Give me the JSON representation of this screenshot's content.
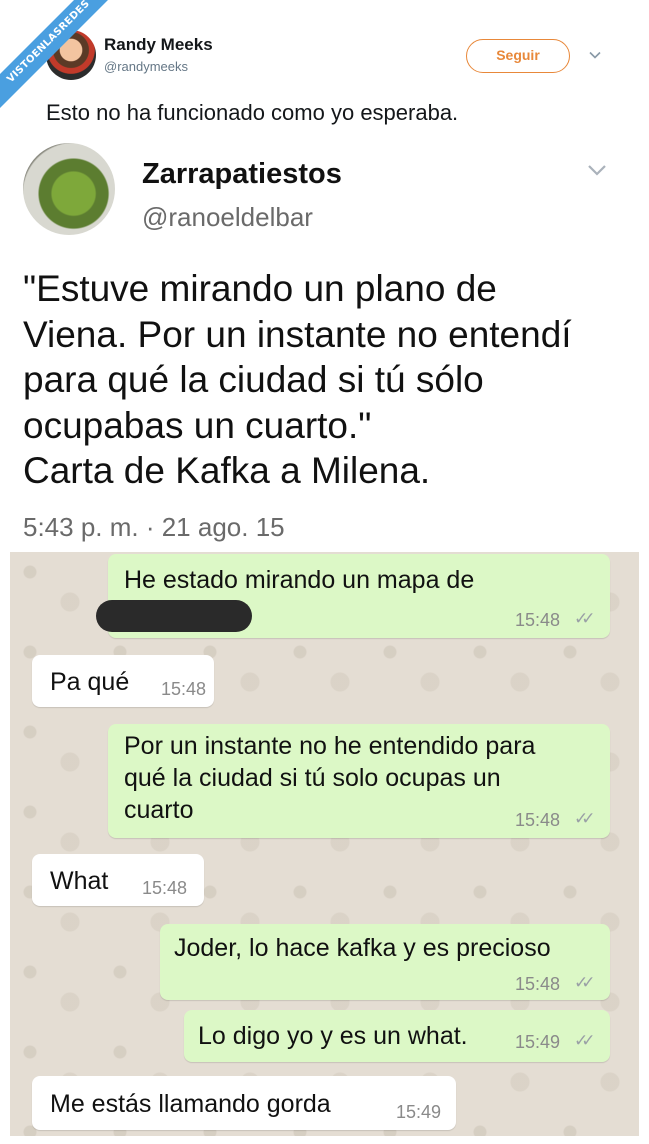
{
  "watermark": "VISTOENLASREDES",
  "tweet": {
    "author_name": "Randy Meeks",
    "author_handle": "@randymeeks",
    "follow_label": "Seguir",
    "text": "Esto no ha funcionado como yo esperaba."
  },
  "embedded_tweet": {
    "author_name": "Zarrapatiestos",
    "author_handle": "@ranoeldelbar",
    "lines": [
      "\"Estuve mirando un plano de",
      "Viena. Por un instante no entendí",
      "para qué la ciudad si tú sólo",
      "ocupabas un cuarto.\"",
      "Carta de Kafka a Milena."
    ],
    "date": "5:43 p. m. · 21 ago. 15"
  },
  "chat": {
    "messages": [
      {
        "direction": "out",
        "lines": [
          "He estado mirando un mapa de"
        ],
        "time": "15:48",
        "redacted": true
      },
      {
        "direction": "in",
        "lines": [
          "Pa qué"
        ],
        "time": "15:48"
      },
      {
        "direction": "out",
        "lines": [
          "Por un instante no he entendido para",
          "qué la ciudad si tú solo ocupas un",
          "cuarto"
        ],
        "time": "15:48"
      },
      {
        "direction": "in",
        "lines": [
          "What"
        ],
        "time": "15:48"
      },
      {
        "direction": "out",
        "lines": [
          "Joder, lo hace kafka y es precioso"
        ],
        "time": "15:48"
      },
      {
        "direction": "out",
        "lines": [
          "Lo digo yo y es un what."
        ],
        "time": "15:49"
      },
      {
        "direction": "in",
        "lines": [
          "Me estás llamando gorda"
        ],
        "time": "15:49"
      }
    ]
  },
  "icons": {
    "tick": "double-check-icon",
    "chevron": "chevron-down-icon"
  }
}
